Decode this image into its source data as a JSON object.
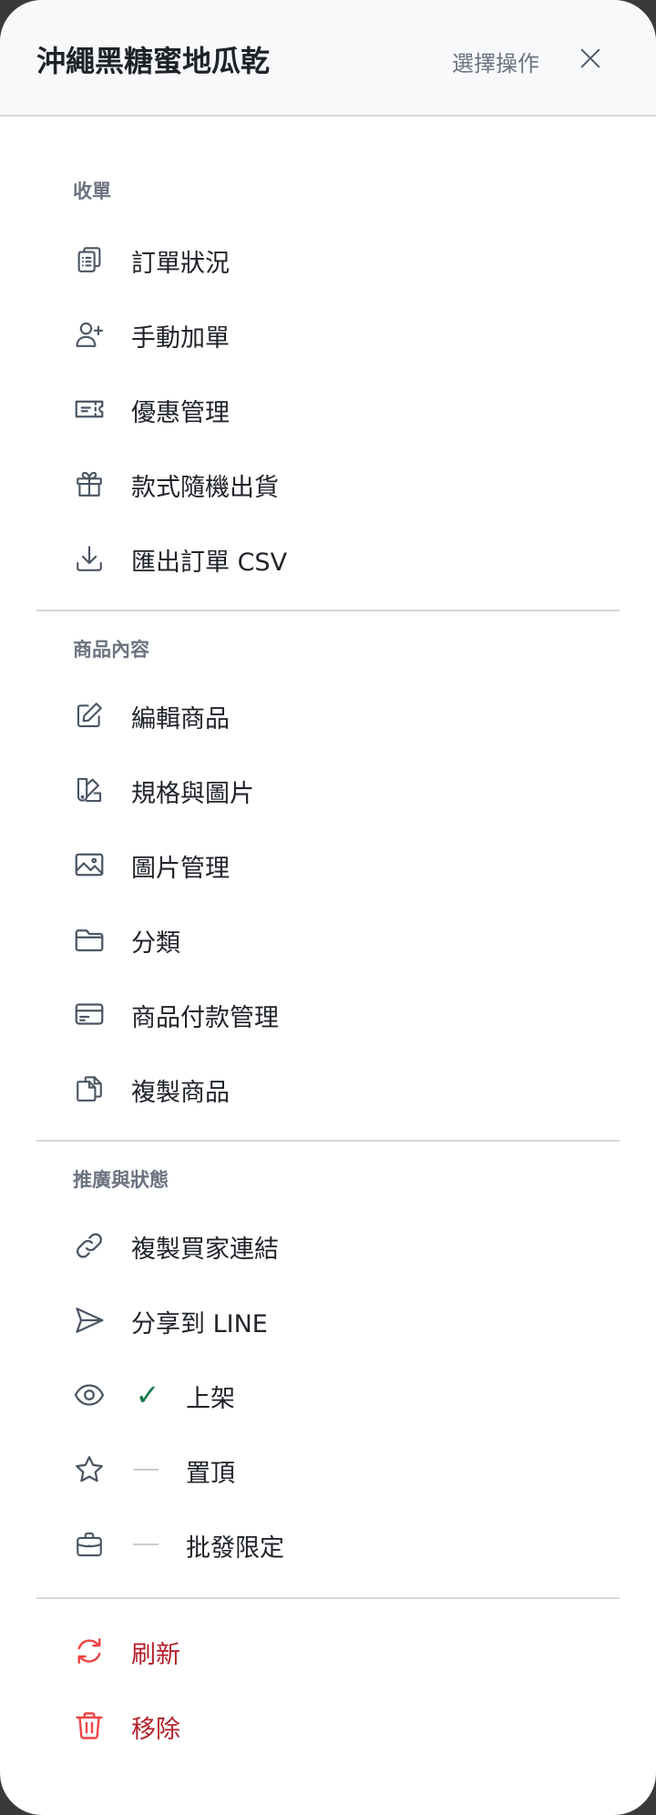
{
  "header": {
    "title": "沖繩黑糖蜜地瓜乾",
    "action_label": "選擇操作"
  },
  "sections": {
    "orders": {
      "label": "收單",
      "items": [
        {
          "label": "訂單狀況",
          "icon": "clipboard-list-icon"
        },
        {
          "label": "手動加單",
          "icon": "user-plus-icon"
        },
        {
          "label": "優惠管理",
          "icon": "ticket-icon"
        },
        {
          "label": "款式隨機出貨",
          "icon": "gift-icon"
        },
        {
          "label": "匯出訂單 CSV",
          "icon": "download-icon"
        }
      ]
    },
    "product": {
      "label": "商品內容",
      "items": [
        {
          "label": "編輯商品",
          "icon": "pencil-square-icon"
        },
        {
          "label": "規格與圖片",
          "icon": "swatch-icon"
        },
        {
          "label": "圖片管理",
          "icon": "image-icon"
        },
        {
          "label": "分類",
          "icon": "folder-icon"
        },
        {
          "label": "商品付款管理",
          "icon": "credit-card-icon"
        },
        {
          "label": "複製商品",
          "icon": "copy-document-icon"
        }
      ]
    },
    "promotion": {
      "label": "推廣與狀態",
      "items": [
        {
          "label": "複製買家連結",
          "icon": "link-icon"
        },
        {
          "label": "分享到 LINE",
          "icon": "paper-plane-icon"
        },
        {
          "label": "上架",
          "icon": "eye-icon",
          "state": "on",
          "state_mark": "✓"
        },
        {
          "label": "置頂",
          "icon": "star-icon",
          "state": "off"
        },
        {
          "label": "批發限定",
          "icon": "briefcase-icon",
          "state": "off"
        }
      ]
    },
    "danger": {
      "items": [
        {
          "label": "刷新",
          "icon": "refresh-icon"
        },
        {
          "label": "移除",
          "icon": "trash-icon"
        }
      ]
    }
  },
  "colors": {
    "text": "#1f2329",
    "muted": "#6b7280",
    "icon": "#4b5563",
    "success": "#157a4a",
    "danger": "#b3202a",
    "danger_icon": "#ef4444",
    "divider": "#d4d7dc",
    "header_bg": "#f8f9fb"
  }
}
